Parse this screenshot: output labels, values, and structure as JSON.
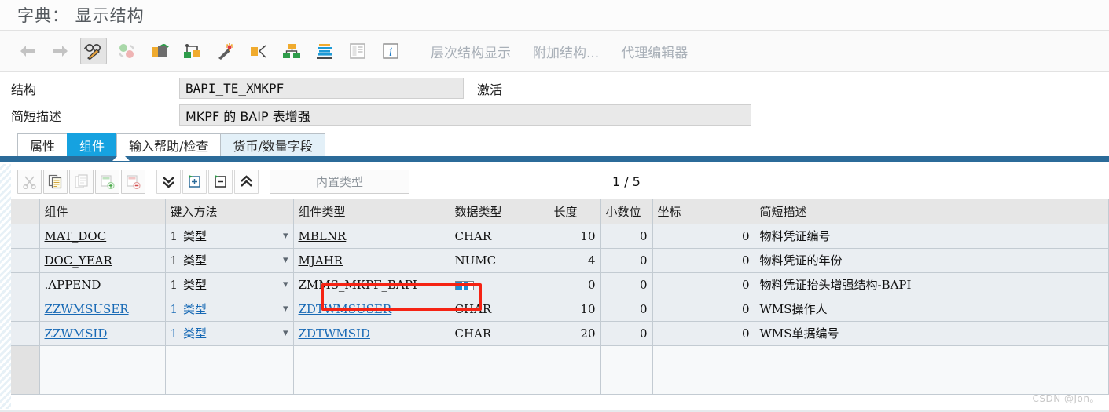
{
  "window": {
    "title": "字典： 显示结构"
  },
  "toolbar": {
    "icons": [
      {
        "name": "back-arrow-icon",
        "selected": false
      },
      {
        "name": "forward-arrow-icon",
        "selected": false
      },
      {
        "name": "display-change-glasses-pencil-icon",
        "selected": true
      },
      {
        "name": "refresh-circles-icon",
        "selected": false
      },
      {
        "name": "copy-object-icon",
        "selected": false
      },
      {
        "name": "where-used-list-icon",
        "selected": false
      },
      {
        "name": "magic-wand-icon",
        "selected": false
      },
      {
        "name": "navigate-object-icon",
        "selected": false
      },
      {
        "name": "hierarchy-structure-icon",
        "selected": false
      },
      {
        "name": "activate-layers-icon",
        "selected": false
      },
      {
        "name": "documentation-icon",
        "selected": false
      },
      {
        "name": "information-icon",
        "selected": false
      }
    ],
    "buttons": [
      {
        "label": "层次结构显示",
        "name": "hierarchy-display-button"
      },
      {
        "label": "附加结构...",
        "name": "append-structure-button"
      },
      {
        "label": "代理编辑器",
        "name": "proxy-editor-button"
      }
    ]
  },
  "form": {
    "structure_label": "结构",
    "structure_value": "BAPI_TE_XMKPF",
    "status": "激活",
    "description_label": "简短描述",
    "description_value": "MKPF 的 BAIP 表增强"
  },
  "tabs": [
    {
      "label": "属性",
      "name": "tab-attributes",
      "state": "normal"
    },
    {
      "label": "组件",
      "name": "tab-components",
      "state": "active"
    },
    {
      "label": "输入帮助/检查",
      "name": "tab-input-help-check",
      "state": "normal"
    },
    {
      "label": "货币/数量字段",
      "name": "tab-currency-quantity-fields",
      "state": "tinted"
    }
  ],
  "grid_toolbar": {
    "icons": [
      {
        "name": "cut-scissors-icon",
        "enabled": false
      },
      {
        "name": "copy-icon",
        "enabled": true
      },
      {
        "name": "paste-icon",
        "enabled": false
      },
      {
        "name": "insert-row-icon",
        "enabled": false
      },
      {
        "name": "delete-row-icon",
        "enabled": false
      },
      {
        "name": "chevron-double-down-icon",
        "enabled": true
      },
      {
        "name": "expand-include-icon",
        "enabled": true
      },
      {
        "name": "collapse-include-icon",
        "enabled": true
      },
      {
        "name": "chevron-double-up-icon",
        "enabled": true
      }
    ],
    "builtin_type_label": "内置类型",
    "page_current": "1",
    "page_separator": "/",
    "page_total": "5"
  },
  "table": {
    "columns": [
      {
        "label": "组件",
        "name": "column-component"
      },
      {
        "label": "键入方法",
        "name": "column-typing-method"
      },
      {
        "label": "组件类型",
        "name": "column-component-type"
      },
      {
        "label": "数据类型",
        "name": "column-data-type"
      },
      {
        "label": "长度",
        "name": "column-length"
      },
      {
        "label": "小数位",
        "name": "column-decimals"
      },
      {
        "label": "坐标",
        "name": "column-coordinate"
      },
      {
        "label": "简短描述",
        "name": "column-short-description"
      }
    ],
    "rows": [
      {
        "component": "MAT_DOC",
        "typing_prefix": "1",
        "typing_method": "类型",
        "component_type": "MBLNR",
        "data_type": "CHAR",
        "length": "10",
        "decimals": "0",
        "coordinate": "0",
        "description": "物料凭证编号",
        "style": "dark",
        "append": false
      },
      {
        "component": "DOC_YEAR",
        "typing_prefix": "1",
        "typing_method": "类型",
        "component_type": "MJAHR",
        "data_type": "NUMC",
        "length": "4",
        "decimals": "0",
        "coordinate": "0",
        "description": "物料凭证的年份",
        "style": "dark",
        "append": false
      },
      {
        "component": ".APPEND",
        "typing_prefix": "1",
        "typing_method": "类型",
        "component_type": "ZMMS_MKPF_BAPI",
        "data_type": "",
        "length": "0",
        "decimals": "0",
        "coordinate": "0",
        "description": "物料凭证抬头增强结构-BAPI",
        "style": "dark",
        "append": true
      },
      {
        "component": "ZZWMSUSER",
        "typing_prefix": "1",
        "typing_method": "类型",
        "component_type": "ZDTWMSUSER",
        "data_type": "CHAR",
        "length": "10",
        "decimals": "0",
        "coordinate": "0",
        "description": "WMS操作人",
        "style": "blue",
        "append": false
      },
      {
        "component": "ZZWMSID",
        "typing_prefix": "1",
        "typing_method": "类型",
        "component_type": "ZDTWMSID",
        "data_type": "CHAR",
        "length": "20",
        "decimals": "0",
        "coordinate": "0",
        "description": "WMS单据编号",
        "style": "blue",
        "append": false
      }
    ],
    "empty_row_count": 2
  },
  "annotation": {
    "highlight_target": "ZMMS_MKPF_BAPI",
    "color": "#f52314"
  },
  "watermark": {
    "text": "CSDN @Jon。"
  },
  "colors": {
    "accent": "#16a2e0",
    "tabbar": "#2b6b99",
    "link": "#1769b5"
  }
}
